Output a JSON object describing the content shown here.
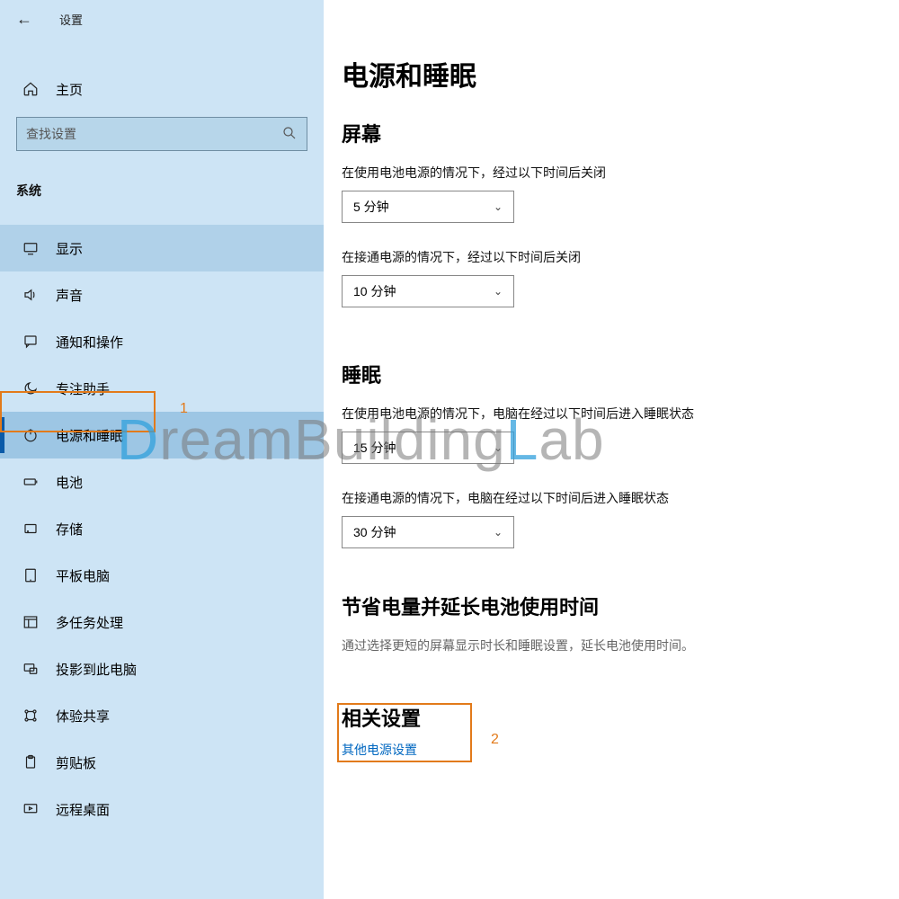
{
  "window": {
    "title": "设置"
  },
  "sidebar": {
    "home": "主页",
    "search_placeholder": "查找设置",
    "group": "系统",
    "items": [
      {
        "icon": "display",
        "label": "显示"
      },
      {
        "icon": "sound",
        "label": "声音"
      },
      {
        "icon": "notify",
        "label": "通知和操作"
      },
      {
        "icon": "focus",
        "label": "专注助手"
      },
      {
        "icon": "power",
        "label": "电源和睡眠"
      },
      {
        "icon": "battery",
        "label": "电池"
      },
      {
        "icon": "storage",
        "label": "存储"
      },
      {
        "icon": "tablet",
        "label": "平板电脑"
      },
      {
        "icon": "multitask",
        "label": "多任务处理"
      },
      {
        "icon": "project",
        "label": "投影到此电脑"
      },
      {
        "icon": "share",
        "label": "体验共享"
      },
      {
        "icon": "clipboard",
        "label": "剪贴板"
      },
      {
        "icon": "remote",
        "label": "远程桌面"
      }
    ]
  },
  "main": {
    "title": "电源和睡眠",
    "screen": {
      "heading": "屏幕",
      "battery_label": "在使用电池电源的情况下，经过以下时间后关闭",
      "battery_value": "5 分钟",
      "plugged_label": "在接通电源的情况下，经过以下时间后关闭",
      "plugged_value": "10 分钟"
    },
    "sleep": {
      "heading": "睡眠",
      "battery_label": "在使用电池电源的情况下，电脑在经过以下时间后进入睡眠状态",
      "battery_value": "15 分钟",
      "plugged_label": "在接通电源的情况下，电脑在经过以下时间后进入睡眠状态",
      "plugged_value": "30 分钟"
    },
    "save": {
      "heading": "节省电量并延长电池使用时间",
      "desc": "通过选择更短的屏幕显示时长和睡眠设置，延长电池使用时间。"
    },
    "related": {
      "heading": "相关设置",
      "link": "其他电源设置"
    }
  },
  "annotations": {
    "a1": "1",
    "a2": "2"
  },
  "watermark": {
    "d": "D",
    "mid": "reamBuilding",
    "l": "L",
    "end": "ab"
  }
}
